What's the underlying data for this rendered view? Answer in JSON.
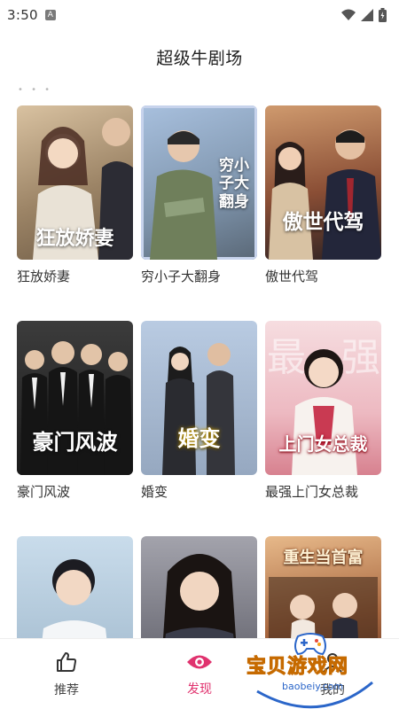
{
  "status_bar": {
    "time": "3:50",
    "app_badge": "A"
  },
  "header": {
    "title": "超级牛剧场"
  },
  "dramas": [
    {
      "label": "狂放娇妻",
      "poster_title": "狂放娇妻",
      "colors": [
        "#c9b08e",
        "#7c6a53"
      ]
    },
    {
      "label": "穷小子大翻身",
      "poster_title": "穷小子大翻身",
      "colors": [
        "#8aa5c8",
        "#4f5e6f"
      ]
    },
    {
      "label": "傲世代驾",
      "poster_title": "傲世代驾",
      "colors": [
        "#b66a3c",
        "#3a2a2a"
      ]
    },
    {
      "label": "豪门风波",
      "poster_title": "豪门风波",
      "colors": [
        "#4a4a4a",
        "#151515"
      ]
    },
    {
      "label": "婚变",
      "poster_title": "婚变",
      "colors": [
        "#a9bcd6",
        "#6a6f7a"
      ]
    },
    {
      "label": "最强上门女总裁",
      "poster_title": "上门女总裁",
      "colors": [
        "#f2c9cf",
        "#c8707f"
      ]
    },
    {
      "label": "",
      "poster_title": "",
      "colors": [
        "#b8d3e6",
        "#6a8aa4"
      ]
    },
    {
      "label": "",
      "poster_title": "",
      "colors": [
        "#8d8d95",
        "#3c3c44"
      ]
    },
    {
      "label": "",
      "poster_title": "重生当首富",
      "colors": [
        "#d9a46b",
        "#6b3d2a"
      ]
    }
  ],
  "tabs": [
    {
      "label": "推荐",
      "icon": "thumbs-up-icon"
    },
    {
      "label": "发现",
      "icon": "eye-icon",
      "active": true
    },
    {
      "label": "我的",
      "icon": "user-icon"
    }
  ],
  "watermark": {
    "text": "宝贝游戏网",
    "url": "baobeiy.com"
  },
  "accent_color": "#e0326e"
}
